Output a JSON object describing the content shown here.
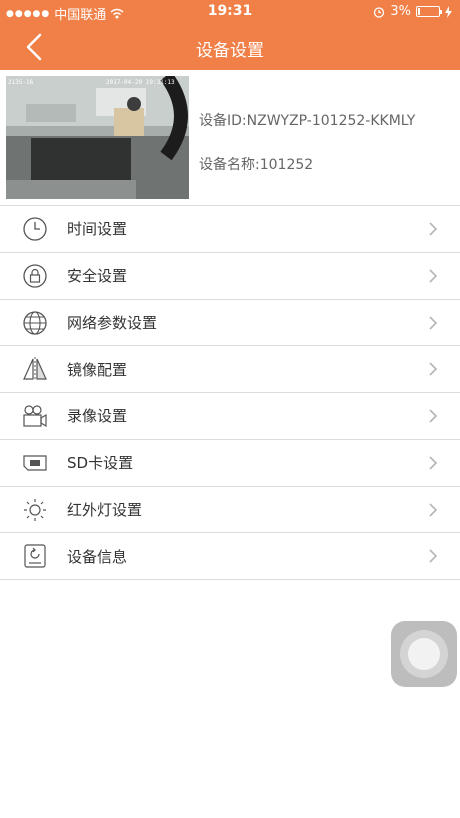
{
  "status_bar": {
    "carrier": "中国联通",
    "time": "19:31",
    "battery": "3%"
  },
  "nav": {
    "title": "设备设置",
    "back_icon": "chevron-left-icon"
  },
  "device": {
    "id_text": "设备ID:NZWYZP-101252-KKMLY",
    "name_text": "设备名称:101252",
    "preview_overlay": {
      "left": "2135-16",
      "datetime": "2017-04-20 19:31:13"
    }
  },
  "menu": {
    "items": [
      {
        "label": "时间设置",
        "icon": "clock-icon"
      },
      {
        "label": "安全设置",
        "icon": "lock-icon"
      },
      {
        "label": "网络参数设置",
        "icon": "globe-icon"
      },
      {
        "label": "镜像配置",
        "icon": "mirror-icon"
      },
      {
        "label": "录像设置",
        "icon": "video-camera-icon"
      },
      {
        "label": "SD卡设置",
        "icon": "sd-card-icon"
      },
      {
        "label": "红外灯设置",
        "icon": "sun-icon"
      },
      {
        "label": "设备信息",
        "icon": "device-info-icon"
      }
    ]
  },
  "colors": {
    "header": "#f08048",
    "text": "#333333",
    "secondary_text": "#666666",
    "divider": "#dcdcdc"
  }
}
